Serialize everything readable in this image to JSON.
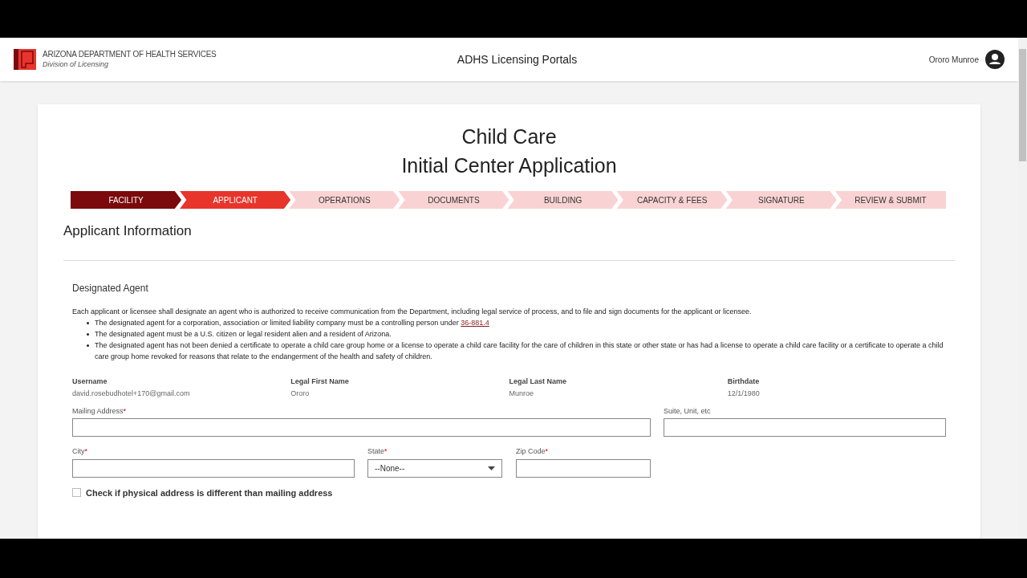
{
  "header": {
    "org": "ARIZONA DEPARTMENT OF HEALTH SERVICES",
    "division": "Division of Licensing",
    "title": "ADHS Licensing Portals",
    "user": "Ororo Munroe"
  },
  "page_title": [
    "Child Care",
    "Initial Center Application"
  ],
  "steps": [
    {
      "label": "FACILITY",
      "completed": true,
      "selected": false
    },
    {
      "label": "APPLICANT",
      "completed": false,
      "selected": true
    },
    {
      "label": "OPERATIONS",
      "completed": false,
      "selected": false
    },
    {
      "label": "DOCUMENTS",
      "completed": false,
      "selected": false
    },
    {
      "label": "BUILDING",
      "completed": false,
      "selected": false
    },
    {
      "label": "CAPACITY & FEES",
      "completed": false,
      "selected": false
    },
    {
      "label": "SIGNATURE",
      "completed": false,
      "selected": false
    },
    {
      "label": "REVIEW & SUBMIT",
      "completed": false,
      "selected": false
    }
  ],
  "section_title": "Applicant Information",
  "agent": {
    "heading": "Designated Agent",
    "intro": "Each applicant or licensee shall designate an agent who is authorized to receive communication from the Department, including legal service of process, and to file and sign documents for the applicant or licensee.",
    "bullets": [
      {
        "text": "The designated agent for a corporation, association or limited liability company must be a controlling person under",
        "link": "36-881.4"
      },
      {
        "text": "The designated agent must be a U.S. citizen or legal resident alien and a resident of Arizona."
      },
      {
        "text": "The designated agent has not been denied a certificate to operate a child care group home or a license to operate a child care facility for the care of children in this state or other state or has had a license to operate a child care facility or a certificate to operate a child care group home revoked for reasons that relate to the endangerment of the health and safety of children."
      }
    ]
  },
  "info": [
    {
      "label": "Username",
      "value": "david.rosebudhotel+170@gmail.com"
    },
    {
      "label": "Legal First Name",
      "value": "Ororo"
    },
    {
      "label": "Legal Last Name",
      "value": "Munroe"
    },
    {
      "label": "Birthdate",
      "value": "12/1/1980"
    }
  ],
  "fields": [
    {
      "label": "Mailing Address",
      "required_mark": "*",
      "kind": "text"
    },
    {
      "label": "Suite, Unit, etc",
      "kind": "text"
    },
    {
      "label": "City",
      "required_mark": "*",
      "kind": "text"
    },
    {
      "label": "State",
      "required_mark": "*",
      "kind": "select",
      "value": "--None--"
    },
    {
      "label": "Zip Code",
      "required_mark": "*",
      "kind": "text"
    }
  ],
  "physical_checkbox": {
    "label": "Check if physical address is different than mailing address",
    "checked": false
  }
}
